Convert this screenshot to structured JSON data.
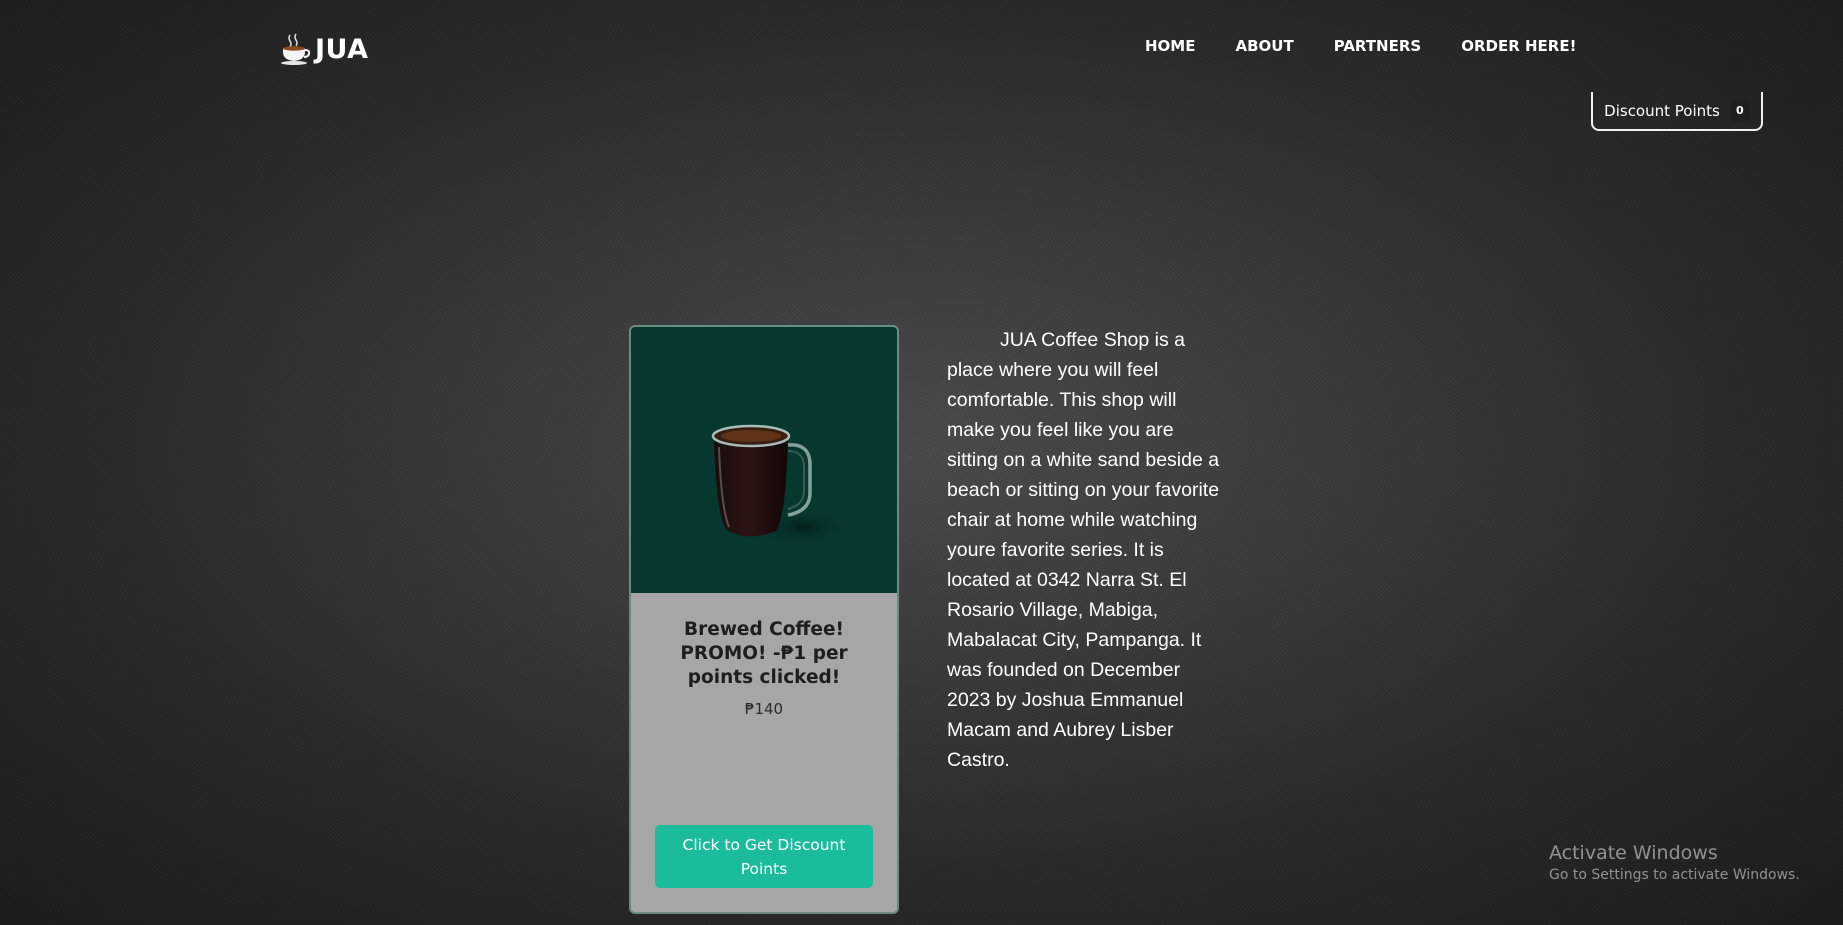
{
  "brand": {
    "icon": "coffee-cup-icon",
    "name": "JUA"
  },
  "nav": {
    "items": [
      {
        "label": "HOME"
      },
      {
        "label": "ABOUT"
      },
      {
        "label": "PARTNERS"
      },
      {
        "label": "ORDER HERE!"
      }
    ]
  },
  "discount": {
    "label": "Discount Points",
    "count": "0"
  },
  "product": {
    "image_icon": "coffee-mug-icon",
    "title": "Brewed Coffee! PROMO! -₱1 per points clicked!",
    "price": "₱140",
    "button_label": "Click to Get Discount Points"
  },
  "about": {
    "text": "JUA Coffee Shop is a place where you will feel comfortable. This shop will make you feel like you are sitting on a white sand beside a beach or sitting on your favorite chair at home while watching youre favorite series. It is located at 0342 Narra St. El Rosario Village, Mabiga, Mabalacat City, Pampanga. It was founded on December 2023 by Joshua Emmanuel Macam and Aubrey Lisber Castro."
  },
  "watermark": {
    "title": "Activate Windows",
    "subtitle": "Go to Settings to activate Windows."
  },
  "colors": {
    "accent": "#1abc9c",
    "product_bg": "#063830",
    "card_bg": "#a6a6a6"
  }
}
